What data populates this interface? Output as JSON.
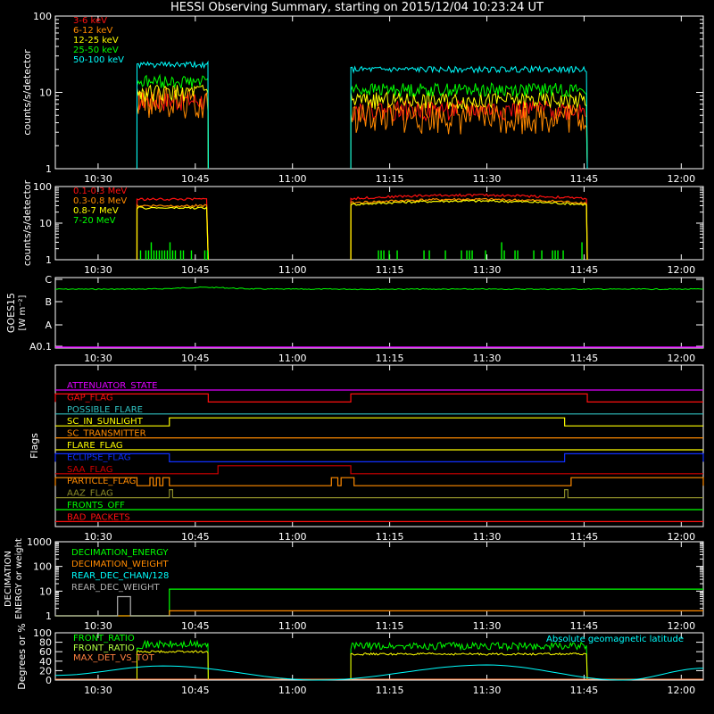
{
  "title": "HESSI Observing Summary, starting on 2015/12/04 10:23:24 UT",
  "colors": {
    "red": "#ff1010",
    "orange": "#ff8a00",
    "yellow": "#ffff00",
    "green": "#00ff00",
    "cyan": "#00ffff",
    "magenta": "#e000ff",
    "blue": "#1030ff",
    "darkred": "#d00000",
    "olive": "#8a8a28",
    "teal": "#30c0c0",
    "gray": "#b0b0b0",
    "lightgreen": "#40ff40",
    "goes": "#00ff00",
    "front2": "#b0ff40",
    "maxdet": "#ff8040"
  },
  "chart_data": [
    {
      "id": "lightcurves",
      "type": "line",
      "ylabel": "counts/s/detector",
      "yscale": "log",
      "ylim": [
        1,
        100
      ],
      "yticks": [
        "1",
        "10",
        "100"
      ],
      "xlim": [
        "10:23:24",
        "12:03:24"
      ],
      "xticks": [
        "10:30",
        "10:45",
        "11:00",
        "11:15",
        "11:30",
        "11:45",
        "12:00"
      ],
      "legend": [
        "3-6 keV",
        "6-12 keV",
        "12-25 keV",
        "25-50 keV",
        "50-100 keV"
      ],
      "intervals": [
        [
          "10:36:00",
          "10:47:00"
        ],
        [
          "11:09:00",
          "11:45:30"
        ]
      ],
      "series": [
        {
          "name": "3-6 keV",
          "values": [
            8,
            6
          ]
        },
        {
          "name": "6-12 keV",
          "values": [
            8,
            5
          ]
        },
        {
          "name": "12-25 keV",
          "values": [
            10,
            8
          ]
        },
        {
          "name": "25-50 keV",
          "values": [
            14,
            11
          ]
        },
        {
          "name": "50-100 keV",
          "values": [
            23,
            20
          ]
        }
      ]
    },
    {
      "id": "highenergy",
      "type": "line",
      "ylabel": "counts/s/detector",
      "yscale": "log",
      "ylim": [
        1,
        100
      ],
      "yticks": [
        "1",
        "10",
        "100"
      ],
      "legend": [
        "0.1-0.3 MeV",
        "0.3-0.8 MeV",
        "0.8-7 MeV",
        "7-20 MeV"
      ],
      "intervals": [
        [
          "10:36:00",
          "10:47:00"
        ],
        [
          "11:09:00",
          "11:45:30"
        ]
      ],
      "series": [
        {
          "name": "0.1-0.3 MeV",
          "values": [
            45,
            55
          ]
        },
        {
          "name": "0.3-0.8 MeV",
          "values": [
            30,
            42
          ]
        },
        {
          "name": "0.8-7 MeV",
          "values": [
            26,
            38
          ]
        },
        {
          "name": "7-20 MeV",
          "values": [
            1.5,
            1.5
          ]
        }
      ]
    },
    {
      "id": "goes",
      "type": "line",
      "ylabel": "GOES15",
      "ylabel2": "[W m⁻²]",
      "yticks": [
        "A0.1",
        "A",
        "B",
        "C"
      ],
      "level": "B",
      "series": [
        {
          "name": "",
          "values": [
            0.9
          ]
        }
      ]
    },
    {
      "id": "flags",
      "type": "line",
      "ylabel": "Flags",
      "series": [
        {
          "name": "ATTENUATOR_STATE",
          "color": "magenta",
          "highs": []
        },
        {
          "name": "GAP_FLAG",
          "color": "red",
          "highs": [
            [
              "10:23:24",
              "10:47:00"
            ],
            [
              "11:09:00",
              "11:45:30"
            ]
          ]
        },
        {
          "name": "POSSIBLE_FLARE",
          "color": "teal",
          "highs": []
        },
        {
          "name": "SC_IN_SUNLIGHT",
          "color": "yellow",
          "highs": [
            [
              "10:41:00",
              "11:42:00"
            ]
          ]
        },
        {
          "name": "SC_TRANSMITTER",
          "color": "orange",
          "highs": []
        },
        {
          "name": "FLARE_FLAG",
          "color": "yellow",
          "highs": []
        },
        {
          "name": "ECLIPSE_FLAG",
          "color": "blue",
          "highs": [
            [
              "10:23:24",
              "10:41:00"
            ],
            [
              "11:42:00",
              "12:03:24"
            ]
          ]
        },
        {
          "name": "SAA_FLAG",
          "color": "darkred",
          "highs": [
            [
              "10:48:30",
              "11:09:00"
            ]
          ]
        },
        {
          "name": "PARTICLE_FLAG",
          "color": "orange",
          "highs": [
            [
              "10:23:24",
              "10:36:00"
            ],
            [
              "10:38:00",
              "10:38:30"
            ],
            [
              "10:39:00",
              "10:39:30"
            ],
            [
              "10:40:00",
              "10:41:00"
            ],
            [
              "11:06:00",
              "11:07:00"
            ],
            [
              "11:07:30",
              "11:09:30"
            ],
            [
              "11:43:00",
              "12:03:24"
            ]
          ]
        },
        {
          "name": "AAZ_FLAG",
          "color": "olive",
          "highs": [
            [
              "10:41:00",
              "10:41:30"
            ],
            [
              "11:42:00",
              "11:42:30"
            ]
          ]
        },
        {
          "name": "FRONTS_OFF",
          "color": "green",
          "highs": []
        },
        {
          "name": "BAD_PACKETS",
          "color": "red",
          "highs": []
        }
      ]
    },
    {
      "id": "decimation",
      "type": "line",
      "ylabel": "DECIMATION",
      "ylabel2": "ENERGY or weight",
      "yscale": "log",
      "ylim": [
        1,
        1000
      ],
      "yticks": [
        "1",
        "10",
        "100",
        "1000"
      ],
      "legend": [
        "DECIMATION_ENERGY",
        "DECIMATION_WEIGHT",
        "REAR_DEC_CHAN/128",
        "REAR_DEC_WEIGHT"
      ],
      "series": [
        {
          "name": "DECIMATION_ENERGY",
          "color": "green",
          "steps": [
            [
              "10:23:24",
              1
            ],
            [
              "10:41:00",
              12
            ]
          ]
        },
        {
          "name": "DECIMATION_WEIGHT",
          "color": "orange",
          "steps": [
            [
              "10:23:24",
              1
            ],
            [
              "10:41:00",
              1.6
            ]
          ]
        },
        {
          "name": "REAR_DEC_CHAN/128",
          "color": "cyan",
          "steps": []
        },
        {
          "name": "REAR_DEC_WEIGHT",
          "color": "gray",
          "steps": [
            [
              "10:23:24",
              1
            ],
            [
              "10:33:00",
              6
            ],
            [
              "10:35:00",
              1
            ]
          ]
        }
      ]
    },
    {
      "id": "ratios",
      "type": "line",
      "ylabel": "Degrees or %",
      "ylim": [
        0,
        100
      ],
      "yticks": [
        "0",
        "20",
        "40",
        "60",
        "80",
        "100"
      ],
      "legend": [
        "FRONT_RATIO",
        "FRONT_RATIO",
        "MAX_DET_VS_TOT"
      ],
      "annotation": "Absolute geomagnetic latitude",
      "series": [
        {
          "name": "FRONT_RATIO",
          "values": [
            75,
            72
          ]
        },
        {
          "name": "FRONT_RATIO",
          "values": [
            60,
            55
          ]
        },
        {
          "name": "MAX_DET_VS_TOT",
          "values": [
            0,
            0
          ]
        },
        {
          "name": "Absolute geomagnetic latitude",
          "peaks": [
            [
              "10:23:24",
              10
            ],
            [
              "10:40:00",
              30
            ],
            [
              "11:04:00",
              0
            ],
            [
              "11:30:00",
              32
            ],
            [
              "11:51:00",
              0
            ],
            [
              "12:03:24",
              25
            ]
          ]
        }
      ]
    }
  ]
}
